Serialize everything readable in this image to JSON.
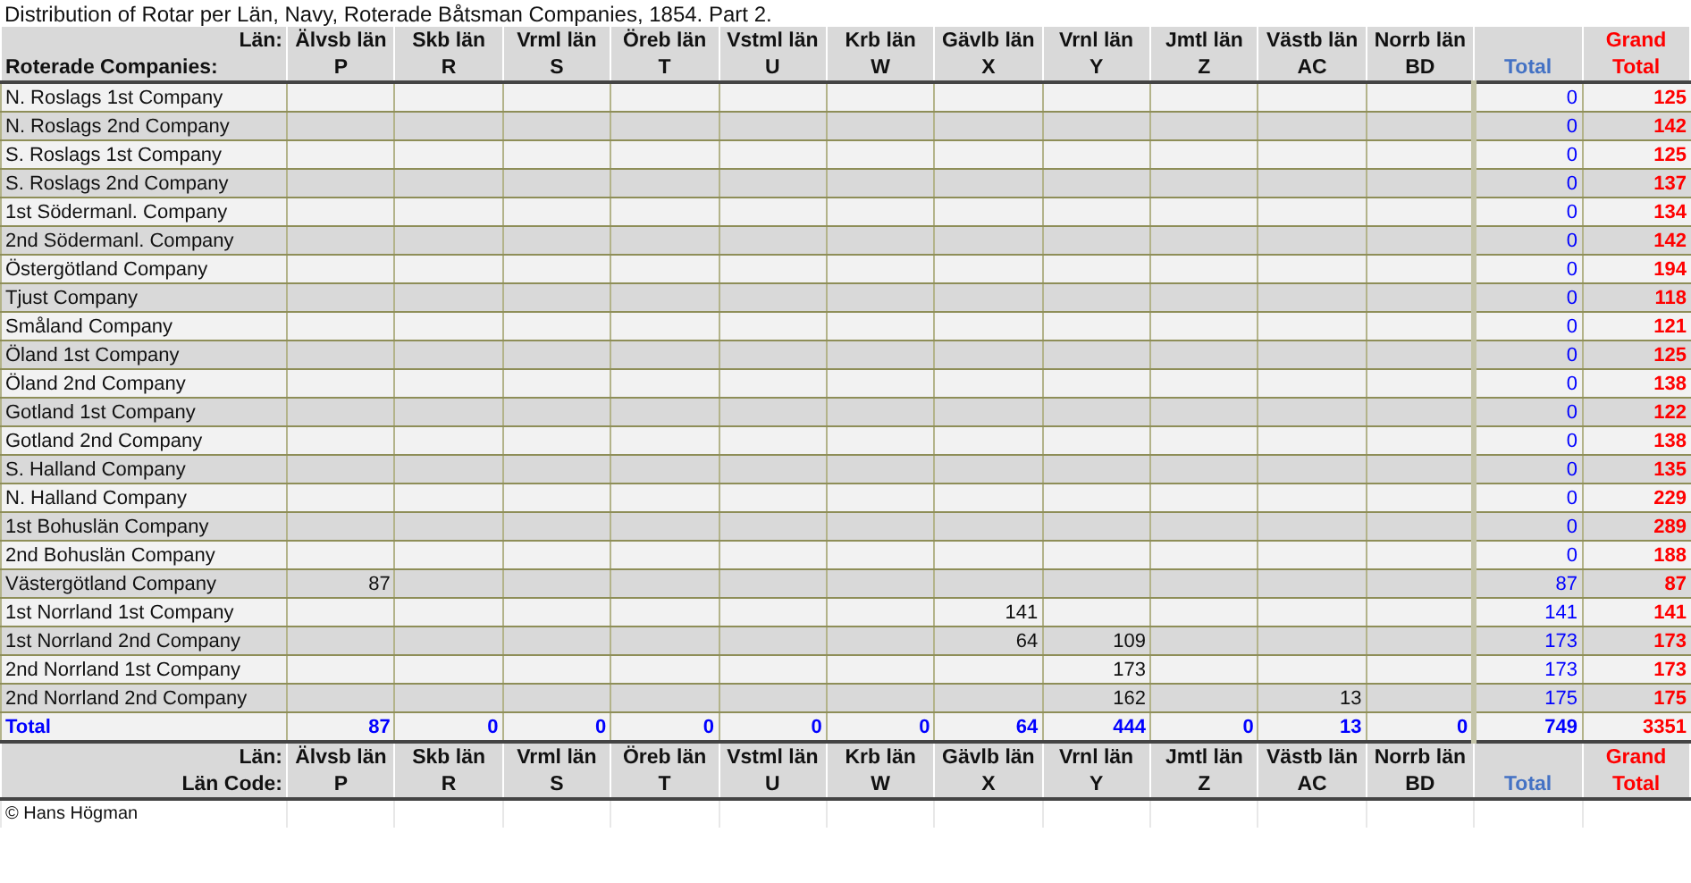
{
  "title": "Distribution of Rotar per Län, Navy, Roterade Båtsman Companies, 1854. Part 2.",
  "header": {
    "lan_label": "Län:",
    "companies_label": "Roterade Companies:",
    "total_label": "Total",
    "grand_top": "Grand",
    "grand_bottom": "Total",
    "columns": [
      {
        "lan": "Älvsb län",
        "code": "P"
      },
      {
        "lan": "Skb län",
        "code": "R"
      },
      {
        "lan": "Vrml län",
        "code": "S"
      },
      {
        "lan": "Öreb län",
        "code": "T"
      },
      {
        "lan": "Vstml län",
        "code": "U"
      },
      {
        "lan": "Krb län",
        "code": "W"
      },
      {
        "lan": "Gävlb län",
        "code": "X"
      },
      {
        "lan": "Vrnl län",
        "code": "Y"
      },
      {
        "lan": "Jmtl län",
        "code": "Z"
      },
      {
        "lan": "Västb län",
        "code": "AC"
      },
      {
        "lan": "Norrb län",
        "code": "BD"
      }
    ]
  },
  "rows": [
    {
      "name": "N. Roslags 1st Company",
      "cells": [
        null,
        null,
        null,
        null,
        null,
        null,
        null,
        null,
        null,
        null,
        null
      ],
      "total": "0",
      "grand": "125"
    },
    {
      "name": "N. Roslags 2nd Company",
      "cells": [
        null,
        null,
        null,
        null,
        null,
        null,
        null,
        null,
        null,
        null,
        null
      ],
      "total": "0",
      "grand": "142"
    },
    {
      "name": "S. Roslags 1st Company",
      "cells": [
        null,
        null,
        null,
        null,
        null,
        null,
        null,
        null,
        null,
        null,
        null
      ],
      "total": "0",
      "grand": "125"
    },
    {
      "name": "S. Roslags 2nd Company",
      "cells": [
        null,
        null,
        null,
        null,
        null,
        null,
        null,
        null,
        null,
        null,
        null
      ],
      "total": "0",
      "grand": "137"
    },
    {
      "name": "1st Södermanl. Company",
      "cells": [
        null,
        null,
        null,
        null,
        null,
        null,
        null,
        null,
        null,
        null,
        null
      ],
      "total": "0",
      "grand": "134"
    },
    {
      "name": "2nd Södermanl. Company",
      "cells": [
        null,
        null,
        null,
        null,
        null,
        null,
        null,
        null,
        null,
        null,
        null
      ],
      "total": "0",
      "grand": "142"
    },
    {
      "name": "Östergötland Company",
      "cells": [
        null,
        null,
        null,
        null,
        null,
        null,
        null,
        null,
        null,
        null,
        null
      ],
      "total": "0",
      "grand": "194"
    },
    {
      "name": "Tjust Company",
      "cells": [
        null,
        null,
        null,
        null,
        null,
        null,
        null,
        null,
        null,
        null,
        null
      ],
      "total": "0",
      "grand": "118"
    },
    {
      "name": "Småland Company",
      "cells": [
        null,
        null,
        null,
        null,
        null,
        null,
        null,
        null,
        null,
        null,
        null
      ],
      "total": "0",
      "grand": "121"
    },
    {
      "name": "Öland 1st Company",
      "cells": [
        null,
        null,
        null,
        null,
        null,
        null,
        null,
        null,
        null,
        null,
        null
      ],
      "total": "0",
      "grand": "125"
    },
    {
      "name": "Öland 2nd Company",
      "cells": [
        null,
        null,
        null,
        null,
        null,
        null,
        null,
        null,
        null,
        null,
        null
      ],
      "total": "0",
      "grand": "138"
    },
    {
      "name": "Gotland 1st Company",
      "cells": [
        null,
        null,
        null,
        null,
        null,
        null,
        null,
        null,
        null,
        null,
        null
      ],
      "total": "0",
      "grand": "122"
    },
    {
      "name": "Gotland 2nd Company",
      "cells": [
        null,
        null,
        null,
        null,
        null,
        null,
        null,
        null,
        null,
        null,
        null
      ],
      "total": "0",
      "grand": "138"
    },
    {
      "name": "S. Halland Company",
      "cells": [
        null,
        null,
        null,
        null,
        null,
        null,
        null,
        null,
        null,
        null,
        null
      ],
      "total": "0",
      "grand": "135"
    },
    {
      "name": "N. Halland Company",
      "cells": [
        null,
        null,
        null,
        null,
        null,
        null,
        null,
        null,
        null,
        null,
        null
      ],
      "total": "0",
      "grand": "229"
    },
    {
      "name": "1st Bohuslän Company",
      "cells": [
        null,
        null,
        null,
        null,
        null,
        null,
        null,
        null,
        null,
        null,
        null
      ],
      "total": "0",
      "grand": "289"
    },
    {
      "name": "2nd Bohuslän Company",
      "cells": [
        null,
        null,
        null,
        null,
        null,
        null,
        null,
        null,
        null,
        null,
        null
      ],
      "total": "0",
      "grand": "188"
    },
    {
      "name": "Västergötland Company",
      "cells": [
        "87",
        null,
        null,
        null,
        null,
        null,
        null,
        null,
        null,
        null,
        null
      ],
      "total": "87",
      "grand": "87"
    },
    {
      "name": "1st Norrland 1st Company",
      "cells": [
        null,
        null,
        null,
        null,
        null,
        null,
        "141",
        null,
        null,
        null,
        null
      ],
      "total": "141",
      "grand": "141"
    },
    {
      "name": "1st Norrland 2nd Company",
      "cells": [
        null,
        null,
        null,
        null,
        null,
        null,
        "64",
        "109",
        null,
        null,
        null
      ],
      "total": "173",
      "grand": "173"
    },
    {
      "name": "2nd Norrland 1st Company",
      "cells": [
        null,
        null,
        null,
        null,
        null,
        null,
        null,
        "173",
        null,
        null,
        null
      ],
      "total": "173",
      "grand": "173"
    },
    {
      "name": "2nd Norrland 2nd Company",
      "cells": [
        null,
        null,
        null,
        null,
        null,
        null,
        null,
        "162",
        null,
        "13",
        null
      ],
      "total": "175",
      "grand": "175"
    }
  ],
  "total_row": {
    "label": "Total",
    "cells": [
      "87",
      "0",
      "0",
      "0",
      "0",
      "0",
      "64",
      "444",
      "0",
      "13",
      "0"
    ],
    "total": "749",
    "grand": "3351"
  },
  "footer_header": {
    "lan_label": "Län:",
    "code_label": "Län Code:",
    "total_label": "Total",
    "grand_top": "Grand",
    "grand_bottom": "Total",
    "columns": [
      {
        "lan": "Älvsb län",
        "code": "P"
      },
      {
        "lan": "Skb län",
        "code": "R"
      },
      {
        "lan": "Vrml län",
        "code": "S"
      },
      {
        "lan": "Öreb län",
        "code": "T"
      },
      {
        "lan": "Vstml län",
        "code": "U"
      },
      {
        "lan": "Krb län",
        "code": "W"
      },
      {
        "lan": "Gävlb län",
        "code": "X"
      },
      {
        "lan": "Vrnl län",
        "code": "Y"
      },
      {
        "lan": "Jmtl län",
        "code": "Z"
      },
      {
        "lan": "Västb län",
        "code": "AC"
      },
      {
        "lan": "Norrb län",
        "code": "BD"
      }
    ]
  },
  "copyright": "© Hans Högman"
}
